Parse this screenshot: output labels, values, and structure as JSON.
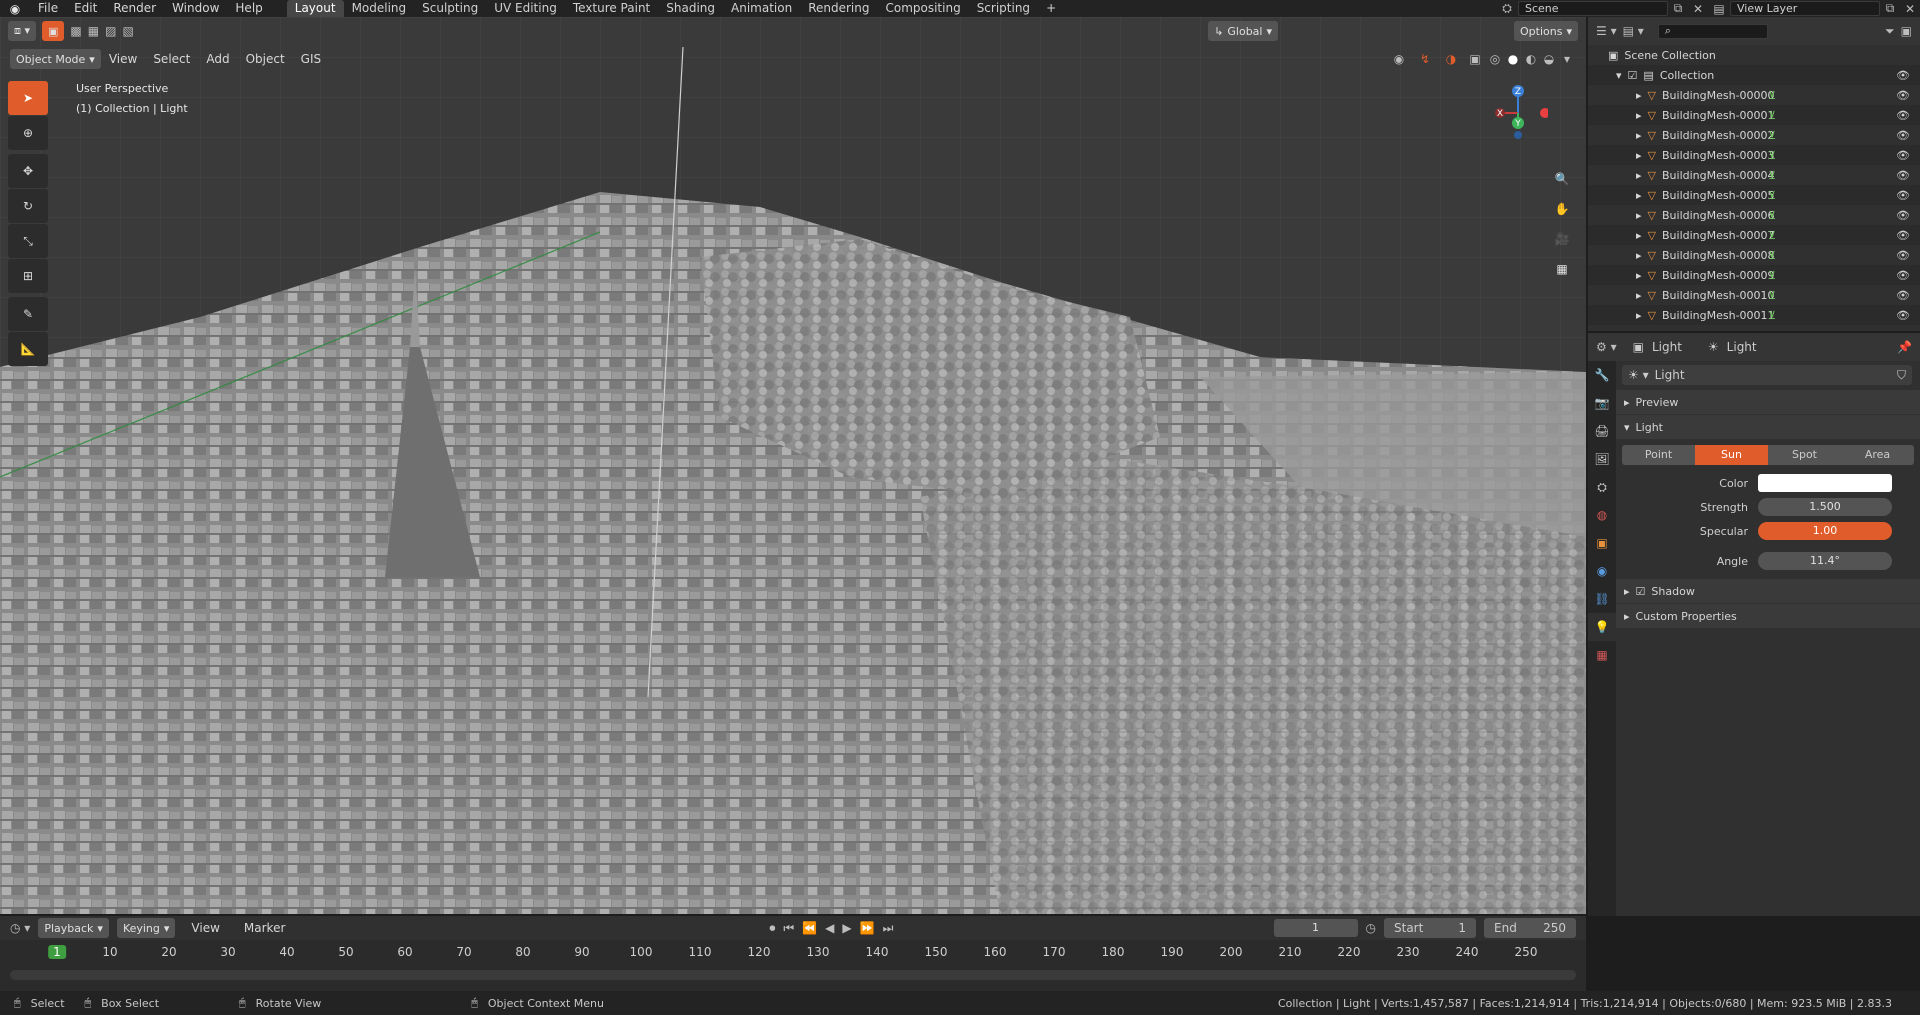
{
  "app": {
    "name": "Blender"
  },
  "topbar": {
    "menus": [
      "File",
      "Edit",
      "Render",
      "Window",
      "Help"
    ],
    "workspaces": [
      "Layout",
      "Modeling",
      "Sculpting",
      "UV Editing",
      "Texture Paint",
      "Shading",
      "Animation",
      "Rendering",
      "Compositing",
      "Scripting"
    ],
    "active_workspace": "Layout",
    "scene": "Scene",
    "view_layer": "View Layer"
  },
  "viewport": {
    "transform_orientation": "Global",
    "options_label": "Options",
    "mode": "Object Mode",
    "menus": [
      "View",
      "Select",
      "Add",
      "Object",
      "GIS"
    ],
    "perspective": "User Perspective",
    "context": "(1) Collection | Light",
    "axes": {
      "x": "X",
      "y": "Y",
      "z": "Z"
    }
  },
  "outliner": {
    "root": "Scene Collection",
    "collection": "Collection",
    "items": [
      "BuildingMesh-00000",
      "BuildingMesh-00001",
      "BuildingMesh-00002",
      "BuildingMesh-00003",
      "BuildingMesh-00004",
      "BuildingMesh-00005",
      "BuildingMesh-00006",
      "BuildingMesh-00007",
      "BuildingMesh-00008",
      "BuildingMesh-00009",
      "BuildingMesh-00010",
      "BuildingMesh-00011"
    ]
  },
  "properties": {
    "breadcrumb_object": "Light",
    "breadcrumb_data": "Light",
    "data_name": "Light",
    "panels": {
      "preview": "Preview",
      "light": "Light",
      "shadow": "Shadow",
      "custom": "Custom Properties"
    },
    "light_types": [
      "Point",
      "Sun",
      "Spot",
      "Area"
    ],
    "active_light_type": "Sun",
    "color_label": "Color",
    "color_value": "#ffffff",
    "strength_label": "Strength",
    "strength": "1.500",
    "specular_label": "Specular",
    "specular": "1.00",
    "angle_label": "Angle",
    "angle": "11.4°",
    "shadow_enabled": true
  },
  "timeline": {
    "menus": [
      "Playback",
      "Keying",
      "View",
      "Marker"
    ],
    "current_frame": "1",
    "start_label": "Start",
    "start": "1",
    "end_label": "End",
    "end": "250",
    "ruler": [
      "1",
      "10",
      "20",
      "30",
      "40",
      "50",
      "60",
      "70",
      "80",
      "90",
      "100",
      "110",
      "120",
      "130",
      "140",
      "150",
      "160",
      "170",
      "180",
      "190",
      "200",
      "210",
      "220",
      "230",
      "240",
      "250"
    ]
  },
  "statusbar": {
    "select": "Select",
    "box_select": "Box Select",
    "rotate": "Rotate View",
    "context_menu": "Object Context Menu",
    "stats": "Collection | Light | Verts:1,457,587 | Faces:1,214,914 | Tris:1,214,914 | Objects:0/680 | Mem: 923.5 MiB | 2.83.3"
  },
  "colors": {
    "accent": "#e05c2b",
    "panel": "#303030",
    "viewport": "#3a3a3a"
  }
}
